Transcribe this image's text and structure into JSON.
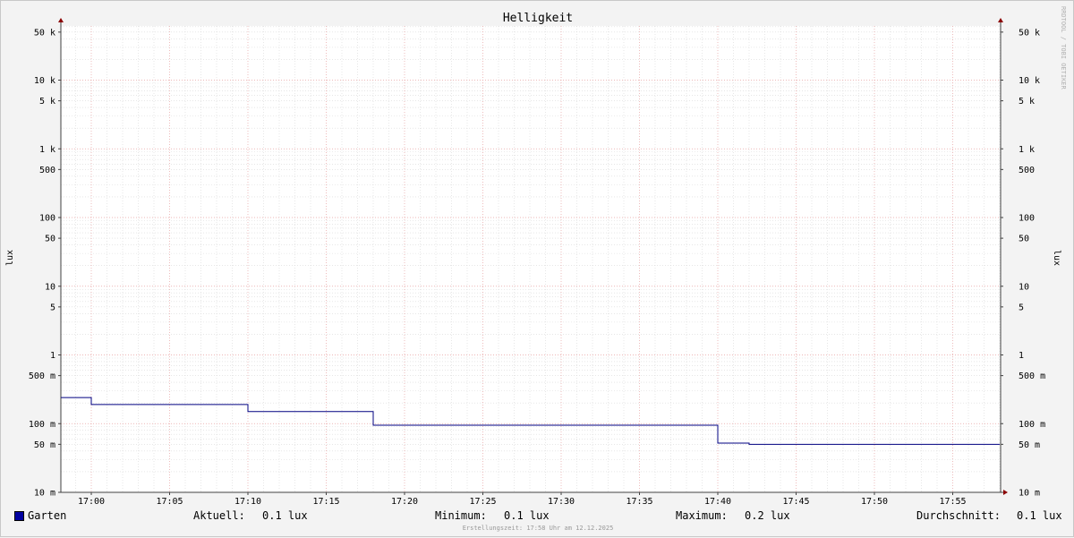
{
  "chart_data": {
    "type": "line",
    "title": "Helligkeit",
    "ylabel": "lux",
    "y_scale": "log",
    "ylim": [
      10,
      80000
    ],
    "y_ticks": [
      {
        "v": 50000,
        "label": "50 k"
      },
      {
        "v": 10000,
        "label": "10 k"
      },
      {
        "v": 5000,
        "label": "5 k"
      },
      {
        "v": 1000,
        "label": "1 k"
      },
      {
        "v": 500,
        "label": "500"
      },
      {
        "v": 100,
        "label": "100"
      },
      {
        "v": 50,
        "label": "50"
      },
      {
        "v": 10,
        "label": "10"
      },
      {
        "v": 5,
        "label": "5"
      },
      {
        "v": 1,
        "label": "1"
      },
      {
        "v": 0.5,
        "label": "500 m"
      },
      {
        "v": 0.1,
        "label": "100 m"
      },
      {
        "v": 0.05,
        "label": "50 m"
      },
      {
        "v": 0.01,
        "label": "10 m"
      }
    ],
    "x_ticks": [
      "17:00",
      "17:05",
      "17:10",
      "17:15",
      "17:20",
      "17:25",
      "17:30",
      "17:35",
      "17:40",
      "17:45",
      "17:50",
      "17:55"
    ],
    "grid": true,
    "series": [
      {
        "name": "Garten",
        "color": "#000080",
        "points": [
          {
            "t": "16:58",
            "v": 0.24
          },
          {
            "t": "17:00",
            "v": 0.19
          },
          {
            "t": "17:10",
            "v": 0.15
          },
          {
            "t": "17:18",
            "v": 0.095
          },
          {
            "t": "17:40",
            "v": 0.052
          },
          {
            "t": "17:42",
            "v": 0.05
          },
          {
            "t": "17:58",
            "v": 0.05
          }
        ]
      }
    ]
  },
  "legend": {
    "series_name": "Garten",
    "series_color": "#0000a0",
    "aktuell_label": "Aktuell:",
    "aktuell_value": "0.1 lux",
    "minimum_label": "Minimum:",
    "minimum_value": "0.1 lux",
    "maximum_label": "Maximum:",
    "maximum_value": "0.2 lux",
    "durchschnitt_label": "Durchschnitt:",
    "durchschnitt_value": "0.1 lux"
  },
  "footer": "Erstellungszeit: 17:58 Uhr am 12.12.2025",
  "watermark": "RRDTOOL / TOBI OETIKER"
}
